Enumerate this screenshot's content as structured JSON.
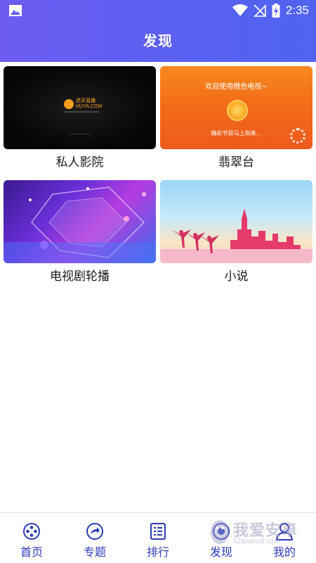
{
  "status_bar": {
    "time": "2:35"
  },
  "header": {
    "title": "发现"
  },
  "cards": [
    {
      "label": "私人影院",
      "thumb_text": {
        "logo_line1": "虎牙直播",
        "logo_line2": "HUYA.COM"
      }
    },
    {
      "label": "翡翠台",
      "thumb_text": {
        "welcome": "欢迎使用橙色电视~",
        "sub": "精彩节目马上到来..."
      }
    },
    {
      "label": "电视剧轮播"
    },
    {
      "label": "小说"
    }
  ],
  "bottom_nav": [
    {
      "label": "首页",
      "icon": "film-reel-icon"
    },
    {
      "label": "专题",
      "icon": "share-arrow-icon"
    },
    {
      "label": "排行",
      "icon": "list-icon"
    },
    {
      "label": "发现",
      "icon": "discover-icon"
    },
    {
      "label": "我的",
      "icon": "person-icon"
    }
  ],
  "watermark": {
    "text": "我爱安卓",
    "sub": "52android.com"
  },
  "colors": {
    "header_start": "#6f5cf2",
    "header_end": "#4f63f1",
    "nav_text": "#2a3bb5"
  }
}
